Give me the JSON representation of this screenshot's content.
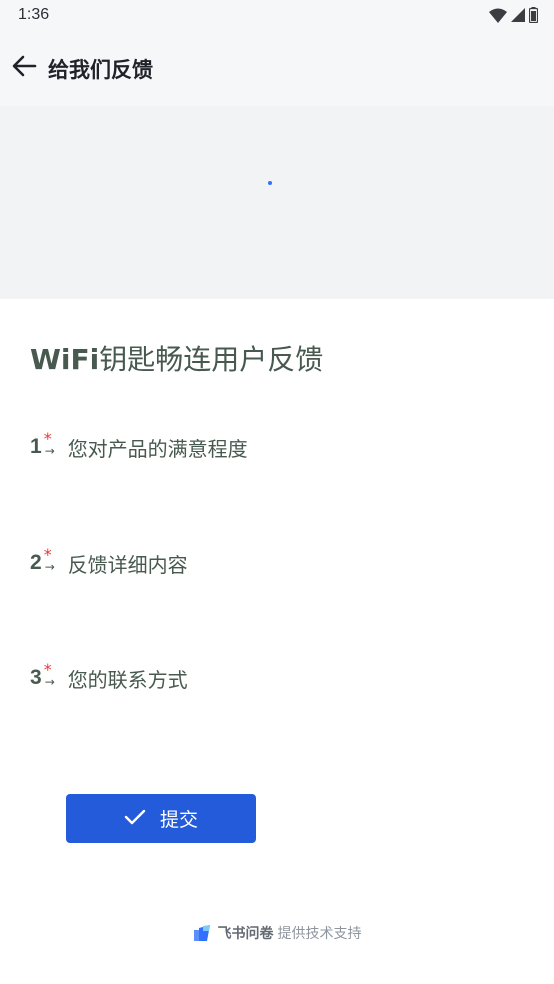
{
  "status_bar": {
    "time": "1:36",
    "icons": [
      "wifi-icon",
      "cellular-signal-icon",
      "battery-icon"
    ]
  },
  "app_bar": {
    "back_icon": "arrow-left-icon",
    "title": "给我们反馈"
  },
  "banner": {
    "background_color": "#f2f3f5",
    "loading_indicator_color": "#3370ff"
  },
  "form": {
    "title_brand": "WiFi",
    "title_rest": "钥匙畅连用户反馈",
    "questions": [
      {
        "number": "1",
        "required_mark": "*",
        "arrow": "→",
        "label": "您对产品的满意程度"
      },
      {
        "number": "2",
        "required_mark": "*",
        "arrow": "→",
        "label": "反馈详细内容"
      },
      {
        "number": "3",
        "required_mark": "*",
        "arrow": "→",
        "label": "您的联系方式"
      }
    ],
    "submit": {
      "icon": "check-icon",
      "label": "提交",
      "color": "#245bdb"
    }
  },
  "footer": {
    "logo_icon": "feishu-survey-logo-icon",
    "brand": "飞书问卷",
    "text": "提供技术支持"
  },
  "colors": {
    "text_primary": "#485a50",
    "required_star": "#e53935",
    "header_bg": "#f6f7f9"
  }
}
